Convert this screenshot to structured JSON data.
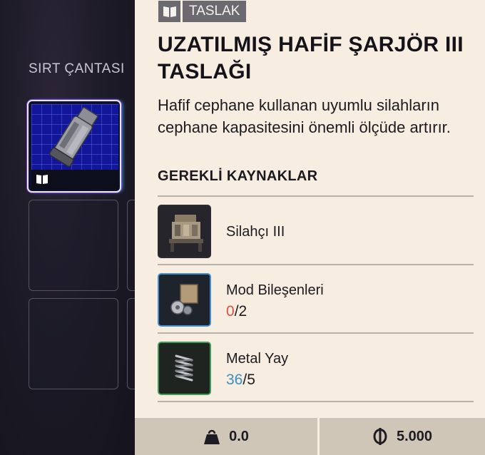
{
  "inventory": {
    "section_title": "SIRT ÇANTASI"
  },
  "item": {
    "tag_icon": "blueprint-book-icon",
    "tag_label": "TASLAK",
    "title": "UZATILMIŞ HAFİF ŞARJÖR III TASLAĞI",
    "description": "Hafif cephane kullanan uyumlu silahların cephane kapasitesini önemli ölçüde artırır."
  },
  "requirements": {
    "title": "GEREKLİ KAYNAKLAR",
    "items": [
      {
        "name": "Silahçı III",
        "icon": "workbench-icon",
        "border_color": "#2a2a30"
      },
      {
        "name": "Mod Bileşenleri",
        "have": "0",
        "sep": "/",
        "need": "2",
        "icon": "mod-components-icon",
        "border_color": "#3f8fd0",
        "have_color": "#e0503e"
      },
      {
        "name": "Metal Yay",
        "have": "36",
        "sep": "/",
        "need": "5",
        "icon": "metal-spring-icon",
        "border_color": "#3e9c58",
        "have_color": "#3a8fc4"
      }
    ]
  },
  "footer": {
    "weight_icon": "weight-icon",
    "weight": "0.0",
    "price_icon": "coin-icon",
    "price": "5.000"
  }
}
